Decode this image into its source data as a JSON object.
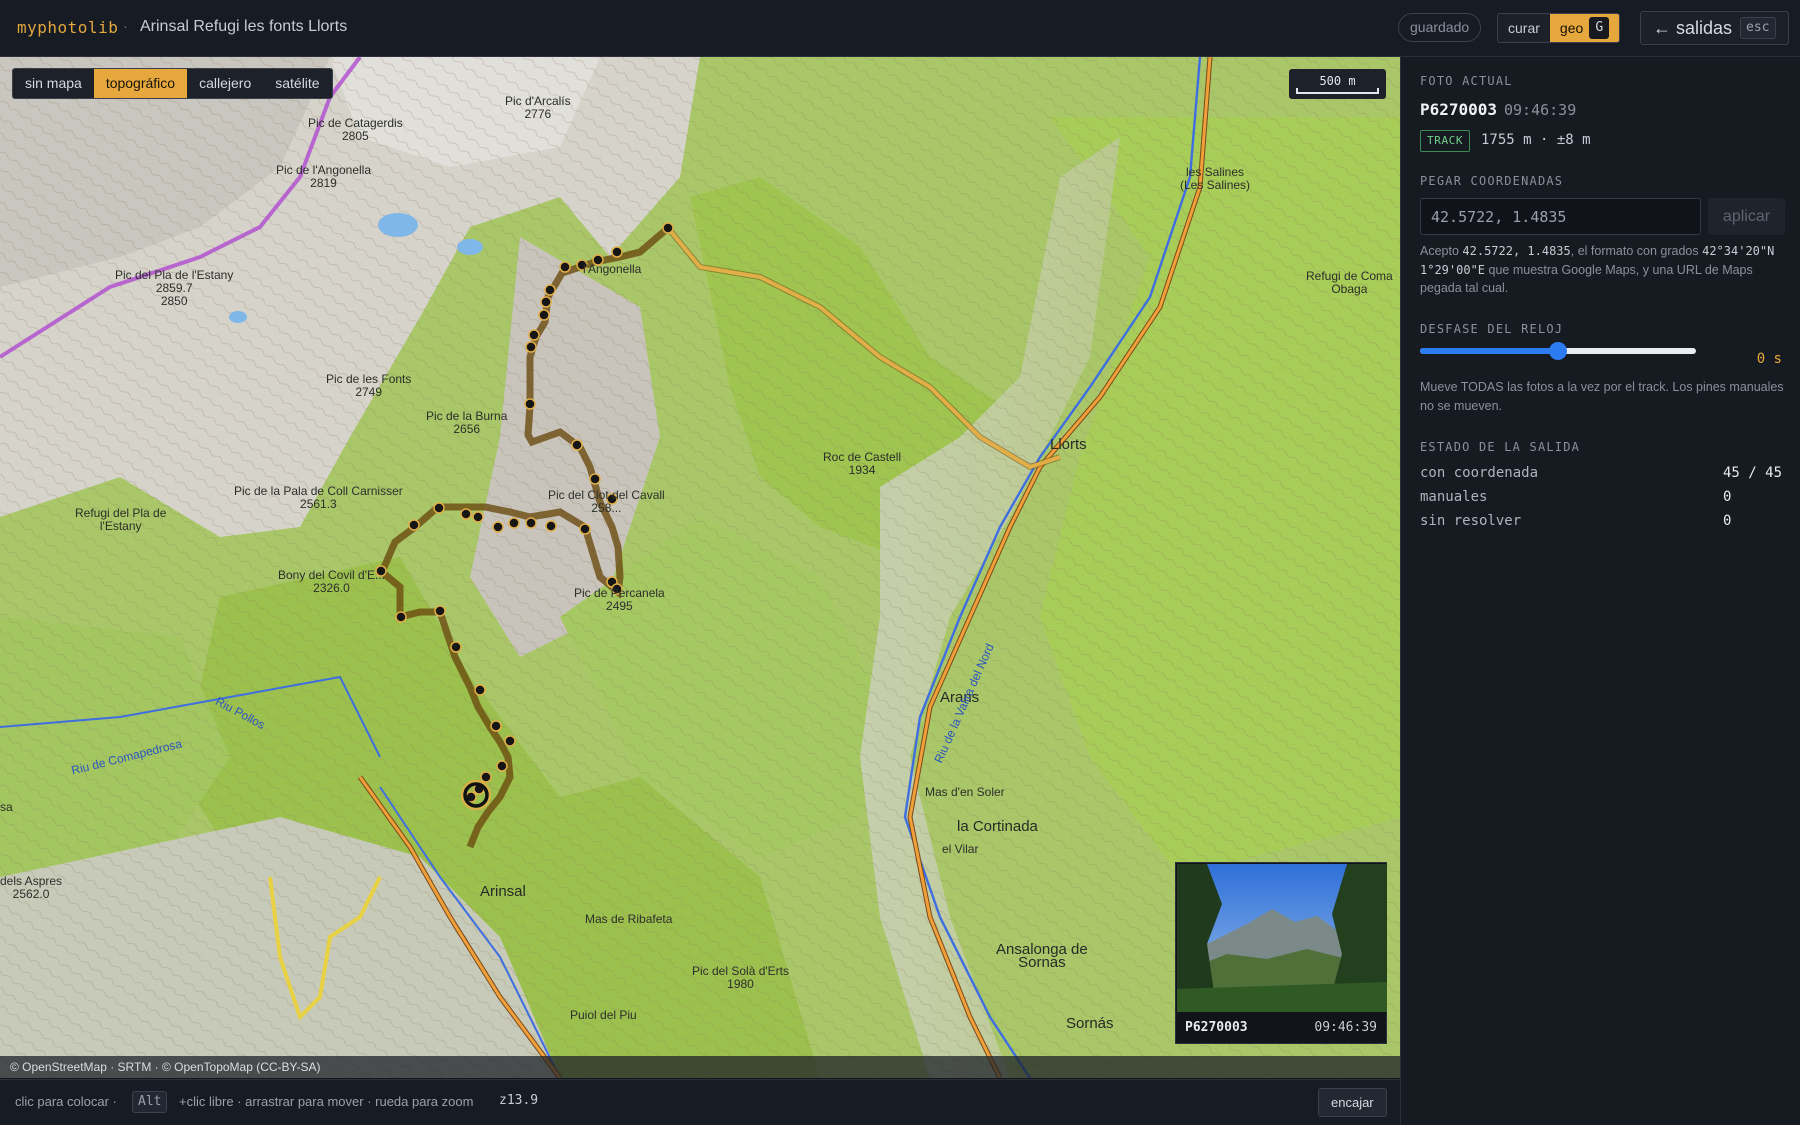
{
  "header": {
    "brand": "myphotolib",
    "separator": "·",
    "title": "Arinsal Refugi les fonts Llorts",
    "saved": "guardado",
    "mode_curar": "curar",
    "mode_geo": "geo",
    "mode_geo_key": "G",
    "exit_label": "← salidas",
    "exit_key": "esc"
  },
  "map": {
    "layers": [
      "sin mapa",
      "topográfico",
      "callejero",
      "satélite"
    ],
    "active_layer": "topográfico",
    "scale": "500 m",
    "attribution": "© OpenStreetMap · SRTM · © OpenTopoMap (CC-BY-SA)",
    "labels": {
      "arcalis": "Pic d'Arcalís\n2776",
      "catagerdis": "Pic de Catagerdis\n2805",
      "angonella_pic": "Pic de l'Angonella\n2819",
      "pla_estany": "Pic del Pla de l'Estany\n2859.7\n2850",
      "fonts": "Pic de les Fonts\n2749",
      "burna": "Pic de la Burna\n2656",
      "pala": "Pic de la Pala de Coll Carnisser\n2561.3",
      "refugi_estany": "Refugi del Pla de\nl'Estany",
      "covil": "Bony del Covil d'E...\n2326.0",
      "clot": "Pic del Clot del Cavall\n258...",
      "percanela": "Pic de Percanela\n2495",
      "angonella": "l'Angonella",
      "castell": "Roc de Castell\n1934",
      "salines": "les Salines\n(Les Salines)",
      "refugi_coma": "Refugi de Coma\nObaga",
      "llorts": "Llorts",
      "arans": "Arans",
      "mas_soler": "Mas d'en Soler",
      "cortinada": "la Cortinada",
      "vilar": "el Vilar",
      "arinsal": "Arinsal",
      "ribafeta": "Mas de Ribafeta",
      "sola": "Pic del Solà d'Erts\n1980",
      "puiol": "Puiol del Piu",
      "ansalonga": "Ansalonga de\nSornas",
      "sornas": "Sornás",
      "aspres": "dels Aspres\n2562.0",
      "sa": "sa",
      "comapedrosa": "Riu de Comapedrosa",
      "pollos": "Riu Pollos",
      "valira": "Riu de la Valira del Nord"
    },
    "thumbnail": {
      "name": "P6270003",
      "time": "09:46:39"
    }
  },
  "footer": {
    "hint_click": "clic para colocar ·",
    "alt_key": "Alt",
    "hint_rest": "+clic libre · arrastrar para mover · rueda para zoom",
    "zoom": "z13.9",
    "fit": "encajar"
  },
  "panel": {
    "current_title": "FOTO ACTUAL",
    "photo_id": "P6270003",
    "photo_time": "09:46:39",
    "track_badge": "TRACK",
    "track_info": "1755 m · ±8 m",
    "paste_title": "PEGAR COORDENADAS",
    "coord_value": "42.5722, 1.4835",
    "apply": "aplicar",
    "help_1": "Acepto ",
    "help_code_1": "42.5722, 1.4835",
    "help_2": ", el formato con grados ",
    "help_code_2": "42°34'20\"N 1°29'00\"E",
    "help_3": " que muestra Google Maps, y una URL de Maps pegada tal cual.",
    "clock_title": "DESFASE DEL RELOJ",
    "clock_offset": "0 s",
    "clock_fraction": 0.5,
    "clock_help": "Mueve TODAS las fotos a la vez por el track. Los pines manuales no se mueven.",
    "state_title": "ESTADO DE LA SALIDA",
    "stats": [
      {
        "label": "con coordenada",
        "value": "45 / 45"
      },
      {
        "label": "manuales",
        "value": "0"
      },
      {
        "label": "sin resolver",
        "value": "0"
      }
    ]
  }
}
